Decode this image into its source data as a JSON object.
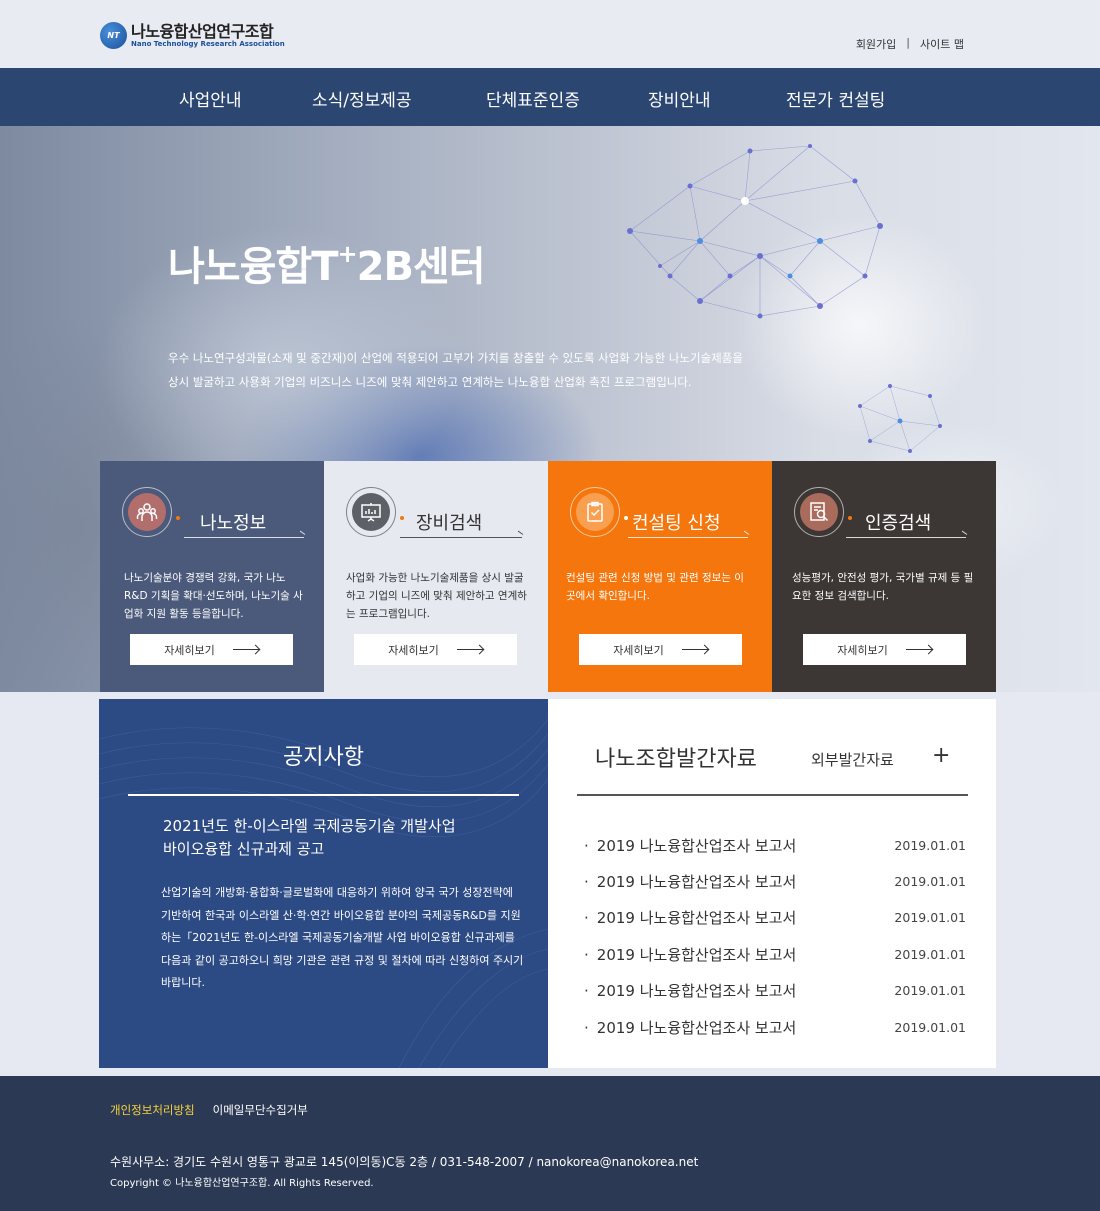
{
  "header": {
    "logo_icon": "nt-logo-icon",
    "logo_mark_text": "NT",
    "logo_title": "나노융합산업연구조합",
    "logo_subtitle": "Nano Technology Research Association",
    "util_links": [
      "회원가입",
      "사이트 맵"
    ],
    "util_separator": "|"
  },
  "nav": {
    "items": [
      "사업안내",
      "소식/정보제공",
      "단체표준인증",
      "장비안내",
      "전문가 컨설팅"
    ]
  },
  "hero": {
    "title_main": "나노융합T",
    "title_sup": "+",
    "title_tail": "2B센터",
    "desc_line1": "우수 나노연구성과물(소재 및 중간재)이 산업에 적용되어 고부가 가치를 창출할 수 있도록 사업화 가능한 나노기술제품을",
    "desc_line2": "상시 발굴하고 사용화 기업의 비즈니스 니즈에 맞춰 제안하고 연계하는 나노융합 산업화 촉진 프로그램입니다."
  },
  "cards": [
    {
      "title": "나노정보",
      "icon": "people-icon",
      "desc": "나노기술분야 경쟁력 강화, 국가 나노 R&D 기획을 확대·선도하며, 나노기술 사업화 지원 활동 등을합니다.",
      "button": "자세히보기"
    },
    {
      "title": "장비검색",
      "icon": "presentation-board-icon",
      "desc": "사업화 가능한 나노기술제품을 상시 발굴하고 기업의 니즈에 맞춰 제안하고 연계하는 프로그램입니다.",
      "button": "자세히보기"
    },
    {
      "title": "컨설팅 신청",
      "icon": "clipboard-check-icon",
      "desc": "컨설팅 관련 신청 방법 및 관련 정보는 이곳에서 확인합니다.",
      "button": "자세히보기"
    },
    {
      "title": "인증검색",
      "icon": "document-search-icon",
      "desc": "성능평가, 안전성 평가, 국가별 규제 등 필요한 정보 검색합니다.",
      "button": "자세히보기"
    }
  ],
  "notice": {
    "title": "공지사항",
    "headline_line1": "2021년도 한-이스라엘 국제공동기술 개발사업",
    "headline_line2": "바이오융합 신규과제 공고",
    "body": "산업기술의 개방화·융합화·글로벌화에 대응하기 위하여 양국 국가 성장전략에 기반하여 한국과 이스라엘 산·학·연간 바이오융합 분야의 국제공동R&D를 지원하는「2021년도 한-이스라엘 국제공동기술개발 사업 바이오융합 신규과제를 다음과 같이 공고하오니 희망 기관은 관련 규정 및 절차에 따라 신청하여 주시기 바랍니다."
  },
  "publications": {
    "title": "나노조합발간자료",
    "external_tab": "외부발간자료",
    "more": "+",
    "items": [
      {
        "name": "2019 나노융합산업조사 보고서",
        "date": "2019.01.01"
      },
      {
        "name": "2019 나노융합산업조사 보고서",
        "date": "2019.01.01"
      },
      {
        "name": "2019 나노융합산업조사 보고서",
        "date": "2019.01.01"
      },
      {
        "name": "2019 나노융합산업조사 보고서",
        "date": "2019.01.01"
      },
      {
        "name": "2019 나노융합산업조사 보고서",
        "date": "2019.01.01"
      },
      {
        "name": "2019 나노융합산업조사 보고서",
        "date": "2019.01.01"
      }
    ]
  },
  "footer": {
    "privacy": "개인정보처리방침",
    "email_refusal": "이메일무단수집거부",
    "address": "수원사무소: 경기도 수원시 영통구 광교로 145(이의동)C동 2층 / 031-548-2007 / nanokorea@nanokorea.net",
    "copyright": "Copyright © 나노융합산업연구조합. All Rights Reserved."
  },
  "colors": {
    "nav_bg": "#2c4672",
    "card1": "#4b5a7a",
    "card2": "#e7e9f1",
    "card3": "#f5760d",
    "card4": "#3c3735",
    "notice_bg": "#2c4a84",
    "footer_bg": "#2b3954",
    "footer_highlight": "#f5d341"
  }
}
